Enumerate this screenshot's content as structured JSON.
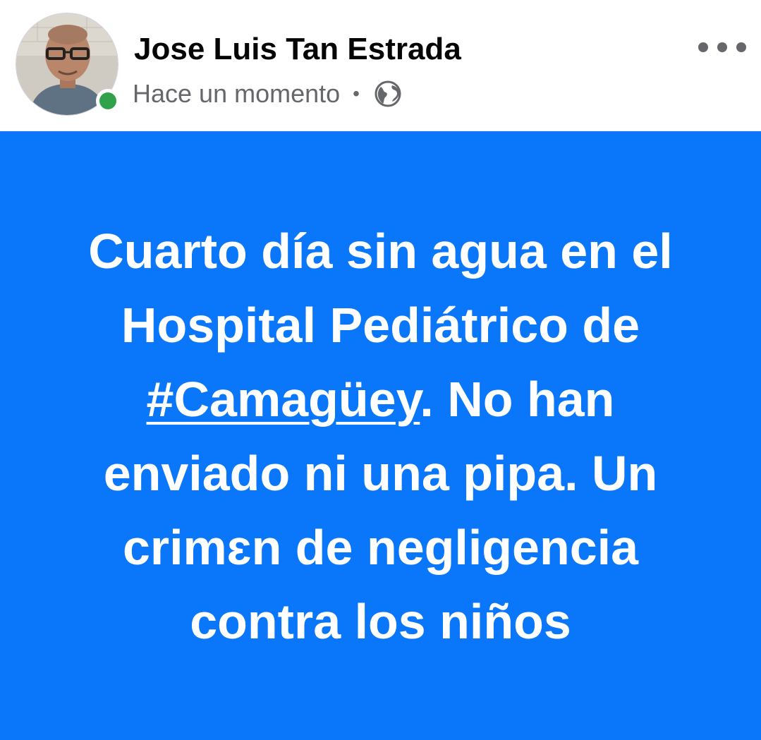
{
  "post": {
    "author_name": "Jose Luis Tan Estrada",
    "timestamp": "Hace un momento",
    "separator": "•",
    "privacy_icon": "globe-icon",
    "more_icon": "more-options-icon",
    "online_status": true,
    "background_color": "#0a77fb",
    "text": {
      "line1": "Cuarto día sin agua en el",
      "line2": "Hospital Pediátrico de",
      "hashtag": "#Camagüey",
      "line3_rest": ". No han",
      "line4": "enviado ni una pipa. Un",
      "line5": "crimɛn de negligencia",
      "line6": "contra los niños"
    }
  }
}
